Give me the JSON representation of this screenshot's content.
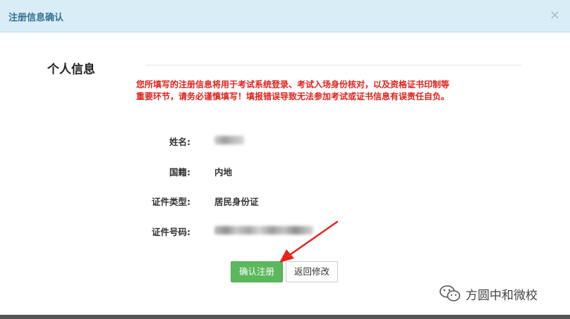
{
  "dialog": {
    "title": "注册信息确认",
    "close_symbol": "×"
  },
  "section": {
    "title": "个人信息",
    "warning": "您所填写的注册信息将用于考试系统登录、考试入场身份核对，以及资格证书印制等重要环节，请务必谨慎填写！填报错误导致无法参加考试或证书信息有误责任自负。"
  },
  "fields": {
    "name_label": "姓名:",
    "nationality_label": "国籍:",
    "nationality_value": "内地",
    "id_type_label": "证件类型:",
    "id_type_value": "居民身份证",
    "id_number_label": "证件号码:"
  },
  "buttons": {
    "confirm": "确认注册",
    "back": "返回修改"
  },
  "watermark": {
    "text": "方圆中和微校",
    "icon": "wechat-icon"
  },
  "colors": {
    "header_bg": "#d9edf7",
    "warning": "#e0211b",
    "confirm_btn": "#5cb85c",
    "arrow": "#e8231b"
  }
}
